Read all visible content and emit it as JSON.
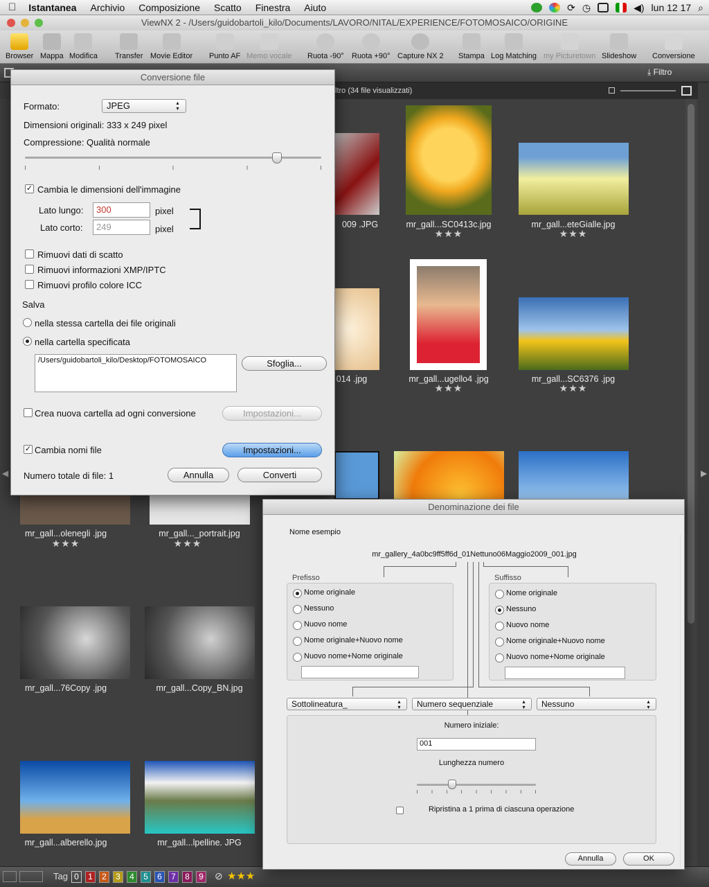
{
  "menubar": {
    "app": "Istantanea",
    "items": [
      "Archivio",
      "Composizione",
      "Scatto",
      "Finestra",
      "Aiuto"
    ],
    "clock": "lun 12 17"
  },
  "window": {
    "title": "ViewNX 2 - /Users/guidobartoli_kilo/Documents/LAVORO/NITAL/EXPERIENCE/FOTOMOSAICO/ORIGINE"
  },
  "toolbar": {
    "items": [
      "Browser",
      "Mappa",
      "Modifica",
      "Transfer",
      "Movie Editor",
      "Punto AF",
      "Memo vocale",
      "Ruota -90°",
      "Ruota +90°",
      "Capture NX 2",
      "Stampa",
      "Log Matching",
      "my Picturetown",
      "Slideshow",
      "Conversione"
    ]
  },
  "subbar": {
    "filter_label": "Filtro"
  },
  "filterbar": {
    "text": "ltro (34 file visualizzati)"
  },
  "thumbs": [
    {
      "label": "009 .JPG",
      "stars": ""
    },
    {
      "label": "mr_gall...SC0413c.jpg",
      "stars": "★★★"
    },
    {
      "label": "mr_gall...eteGialle.jpg",
      "stars": "★★★"
    },
    {
      "label": "014 .jpg",
      "stars": ""
    },
    {
      "label": "mr_gall...ugello4 .jpg",
      "stars": "★★★"
    },
    {
      "label": "mr_gall...SC6376 .jpg",
      "stars": "★★★"
    },
    {
      "label": "mr_gall...olenegli .jpg",
      "stars": "★★★"
    },
    {
      "label": "mr_gall..._portrait.jpg",
      "stars": "★★★"
    },
    {
      "label": "mr_gall...76Copy .jpg",
      "stars": ""
    },
    {
      "label": "mr_gall...Copy_BN.jpg",
      "stars": ""
    },
    {
      "label": "mr_gall...alberello.jpg",
      "stars": ""
    },
    {
      "label": "mr_gall...lpelline. JPG",
      "stars": ""
    }
  ],
  "bottombar": {
    "tag_label": "Tag",
    "tags": [
      "0",
      "1",
      "2",
      "3",
      "4",
      "5",
      "6",
      "7",
      "8",
      "9"
    ]
  },
  "conv": {
    "title": "Conversione file",
    "format_label": "Formato:",
    "format_value": "JPEG",
    "orig_dims": "Dimensioni originali: 333 x 249 pixel",
    "compression": "Compressione: Qualità normale",
    "compression_level": 0.85,
    "resize_label": "Cambia le dimensioni dell'immagine",
    "long_label": "Lato lungo:",
    "long_value": "300",
    "short_label": "Lato corto:",
    "short_value": "249",
    "pixel": "pixel",
    "remove_shot": "Rimuovi dati di scatto",
    "remove_xmp": "Rimuovi informazioni XMP/IPTC",
    "remove_icc": "Rimuovi profilo colore ICC",
    "save_label": "Salva",
    "save_same": "nella stessa cartella dei file originali",
    "save_spec": "nella cartella specificata",
    "path": "/Users/guidobartoli_kilo/Desktop/FOTOMOSAICO",
    "browse": "Sfoglia...",
    "new_folder": "Crea nuova cartella ad ogni conversione",
    "settings": "Impostazioni...",
    "rename": "Cambia nomi file",
    "settings2": "Impostazioni...",
    "total": "Numero totale di file: 1",
    "cancel": "Annulla",
    "convert": "Converti"
  },
  "naming": {
    "title": "Denominazione dei file",
    "example_label": "Nome esempio",
    "example": "mr_gallery_4a0bc9ff5ff6d_01Nettuno06Maggio2009_001.jpg",
    "prefix_label": "Prefisso",
    "suffix_label": "Suffisso",
    "prefix_opts": [
      "Nome originale",
      "Nessuno",
      "Nuovo nome",
      "Nome originale+Nuovo nome",
      "Nuovo nome+Nome originale"
    ],
    "suffix_opts": [
      "Nome originale",
      "Nessuno",
      "Nuovo nome",
      "Nome originale+Nuovo nome",
      "Nuovo nome+Nome originale"
    ],
    "sep": "Sottolineatura_",
    "seq": "Numero sequenziale",
    "none": "Nessuno",
    "start_label": "Numero iniziale:",
    "start_value": "001",
    "length_label": "Lunghezza numero",
    "reset": "Ripristina a 1 prima di ciascuna operazione",
    "cancel": "Annulla",
    "ok": "OK"
  }
}
